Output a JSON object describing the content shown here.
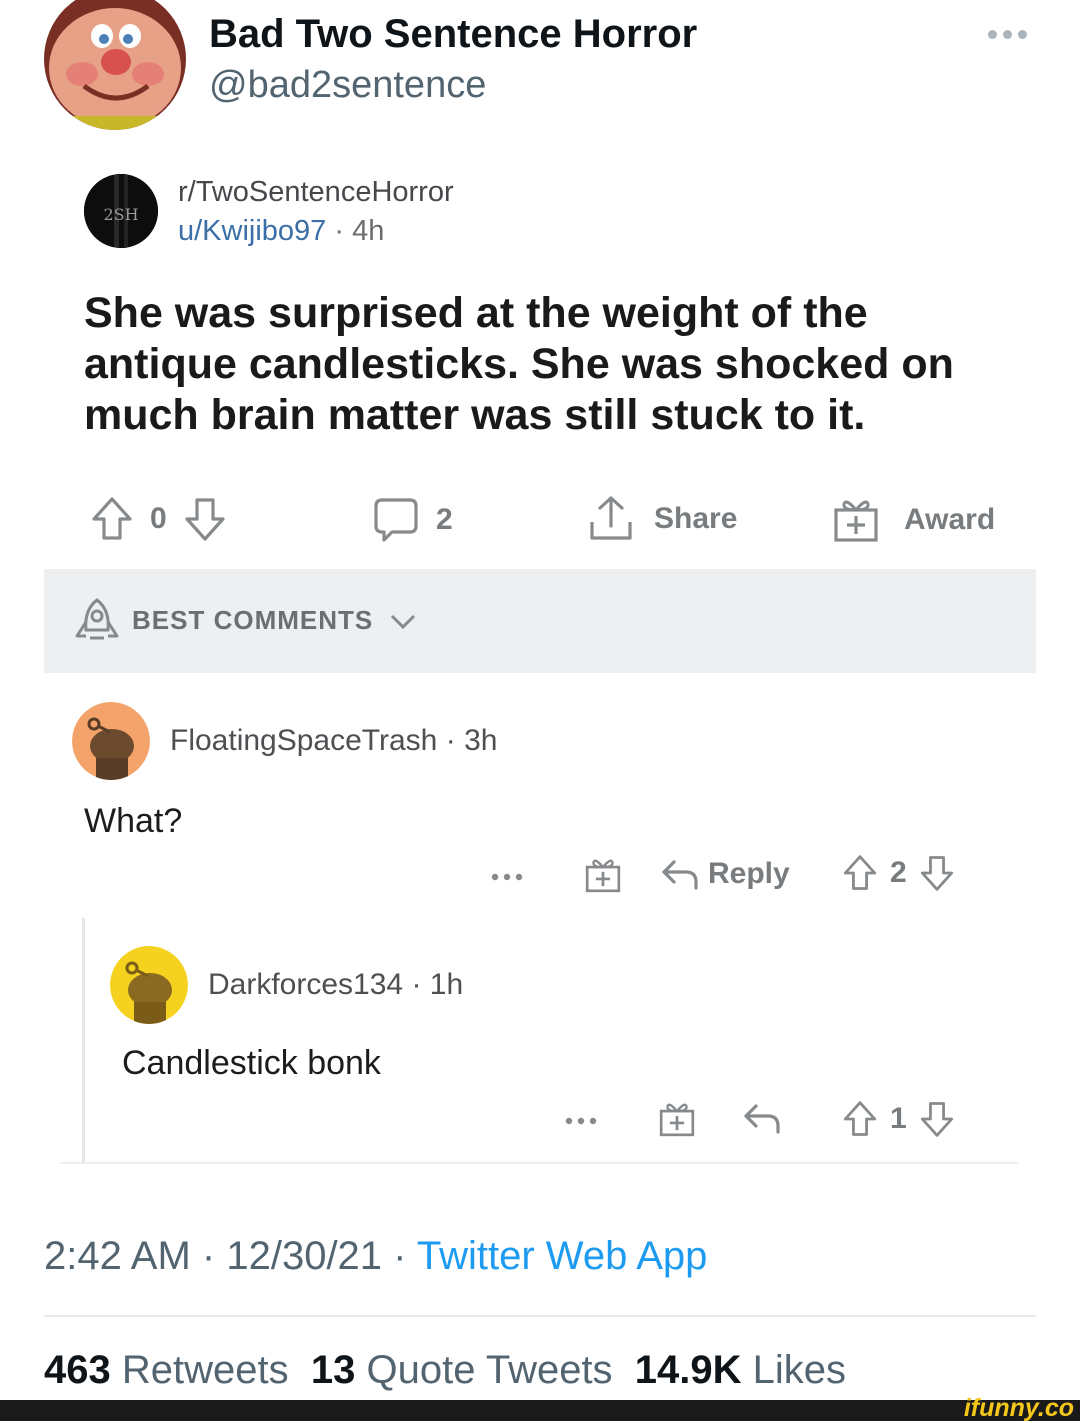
{
  "tweet": {
    "display_name": "Bad Two Sentence Horror",
    "handle": "@bad2sentence",
    "more_icon": "more-dots-icon"
  },
  "reddit_post": {
    "subreddit": "r/TwoSentenceHorror",
    "subreddit_avatar_text": "2SH",
    "user": "u/Kwijibo97",
    "separator": "·",
    "age": "4h",
    "title": "She was surprised at the weight of the antique candlesticks. She was shocked on much brain matter was still stuck to it.",
    "votes": "0",
    "comments": "2",
    "share_label": "Share",
    "award_label": "Award",
    "best_comments_label": "BEST COMMENTS"
  },
  "comments": [
    {
      "author": "FloatingSpaceTrash",
      "separator": "·",
      "age": "3h",
      "body": "What?",
      "reply_label": "Reply",
      "votes": "2",
      "avatar_color": "#f4a46a"
    },
    {
      "author": "Darkforces134",
      "separator": "·",
      "age": "1h",
      "body": "Candlestick bonk",
      "votes": "1",
      "avatar_color": "#f4d21f"
    }
  ],
  "footer": {
    "time": "2:42 AM",
    "date": "12/30/21",
    "separator": "·",
    "app": "Twitter Web App",
    "retweets_count": "463",
    "retweets_label": "Retweets",
    "quotes_count": "13",
    "quotes_label": "Quote Tweets",
    "likes_count": "14.9K",
    "likes_label": "Likes"
  },
  "watermark": "ifunny.co",
  "colors": {
    "link_blue": "#1d9bf0",
    "reddit_user_blue": "#3c6fa8",
    "muted_gray": "#536471"
  }
}
